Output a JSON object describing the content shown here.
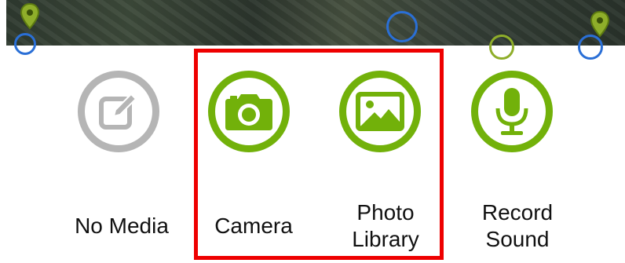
{
  "colors": {
    "accent_green": "#72b10a",
    "disabled_gray": "#b5b5b5",
    "highlight_red": "#ee0000",
    "map_marker_blue": "#2a6fd6"
  },
  "media_options": [
    {
      "id": "no-media",
      "label": "No Media",
      "icon": "edit-icon",
      "enabled": false
    },
    {
      "id": "camera",
      "label": "Camera",
      "icon": "camera-icon",
      "enabled": true
    },
    {
      "id": "photo-library",
      "label": "Photo\nLibrary",
      "icon": "photo-icon",
      "enabled": true
    },
    {
      "id": "record-sound",
      "label": "Record\nSound",
      "icon": "microphone-icon",
      "enabled": true
    }
  ]
}
